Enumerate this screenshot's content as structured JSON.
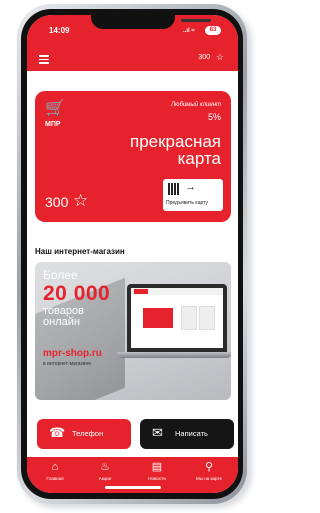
{
  "status_bar": {
    "time": "14:09",
    "signal": "..ıl ≈",
    "battery": "83"
  },
  "header": {
    "menu_icon": "menu-icon",
    "points": "300",
    "star_icon": "star-icon"
  },
  "card": {
    "logo": "МПР",
    "favorite_label": "Любимый клиент",
    "percent": "5%",
    "title_line1": "прекрасная",
    "title_line2": "карта",
    "balance": "300",
    "show_card_label": "Предъявить карту"
  },
  "section_title": "Наш интернет-магазин",
  "banner": {
    "more": "Более",
    "number": "20 000",
    "goods": "товаров",
    "online": "онлайн",
    "site": "mpr-shop.ru",
    "subtitle": "в интернет-магазине"
  },
  "actions": {
    "phone_label": "Телефон",
    "write_label": "Написать"
  },
  "bottom_nav": [
    {
      "label": "Главная",
      "icon": "home-icon"
    },
    {
      "label": "Акции",
      "icon": "fire-icon"
    },
    {
      "label": "Новости",
      "icon": "news-icon"
    },
    {
      "label": "Мы на карте",
      "icon": "map-pin-icon"
    }
  ],
  "colors": {
    "brand_red": "#e6232d",
    "dark_button": "#151515"
  }
}
